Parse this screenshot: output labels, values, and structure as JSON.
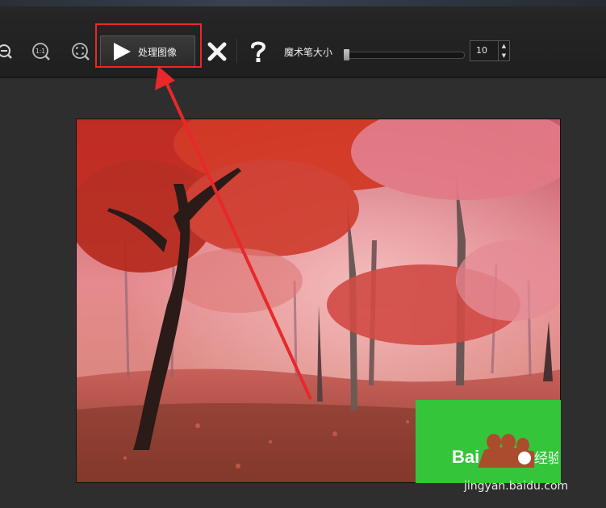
{
  "toolbar": {
    "process_label": "处理图像",
    "brush_size_label": "魔术笔大小",
    "brush_size_value": "10",
    "brush_slider_level": 0.0
  },
  "icons": {
    "zoom_out": "zoom-out-icon",
    "actual_size": "zoom-1-1-icon",
    "fit": "fit-to-window-icon",
    "play": "play-icon",
    "close": "close-icon",
    "help": "help-icon"
  },
  "watermark": {
    "logo_text": "Bai",
    "logo_text2": "经验",
    "site": "jingyan.baidu.com"
  },
  "colors": {
    "highlight": "#e8282a",
    "watermark_green": "#35c53b"
  }
}
